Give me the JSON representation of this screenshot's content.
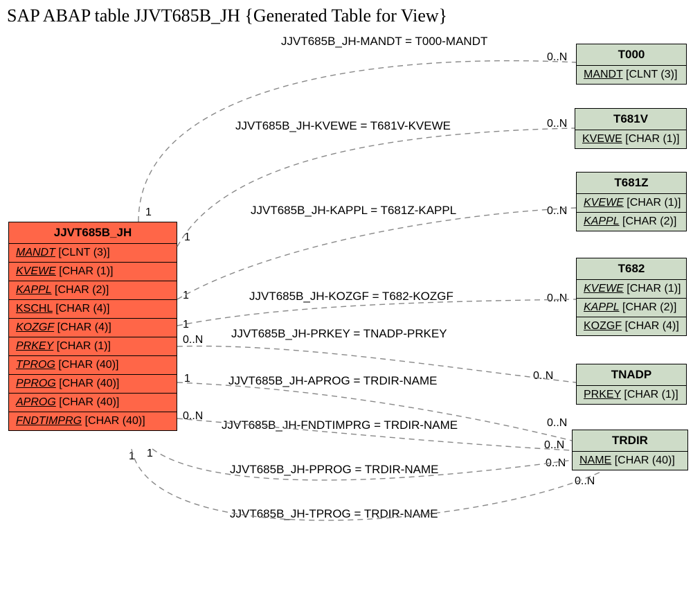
{
  "title": "SAP ABAP table JJVT685B_JH {Generated Table for View}",
  "main": {
    "name": "JJVT685B_JH",
    "fields": [
      {
        "name": "MANDT",
        "type": "[CLNT (3)]",
        "style": "fk"
      },
      {
        "name": "KVEWE",
        "type": "[CHAR (1)]",
        "style": "fk"
      },
      {
        "name": "KAPPL",
        "type": "[CHAR (2)]",
        "style": "fk"
      },
      {
        "name": "KSCHL",
        "type": "[CHAR (4)]",
        "style": "k"
      },
      {
        "name": "KOZGF",
        "type": "[CHAR (4)]",
        "style": "fk"
      },
      {
        "name": "PRKEY",
        "type": "[CHAR (1)]",
        "style": "fk"
      },
      {
        "name": "TPROG",
        "type": "[CHAR (40)]",
        "style": "fk"
      },
      {
        "name": "PPROG",
        "type": "[CHAR (40)]",
        "style": "fk"
      },
      {
        "name": "APROG",
        "type": "[CHAR (40)]",
        "style": "fk"
      },
      {
        "name": "FNDTIMPRG",
        "type": "[CHAR (40)]",
        "style": "fk"
      }
    ]
  },
  "targets": [
    {
      "name": "T000",
      "fields": [
        {
          "name": "MANDT",
          "type": "[CLNT (3)]",
          "style": "k"
        }
      ]
    },
    {
      "name": "T681V",
      "fields": [
        {
          "name": "KVEWE",
          "type": "[CHAR (1)]",
          "style": "k"
        }
      ]
    },
    {
      "name": "T681Z",
      "fields": [
        {
          "name": "KVEWE",
          "type": "[CHAR (1)]",
          "style": "fk"
        },
        {
          "name": "KAPPL",
          "type": "[CHAR (2)]",
          "style": "fk"
        }
      ]
    },
    {
      "name": "T682",
      "fields": [
        {
          "name": "KVEWE",
          "type": "[CHAR (1)]",
          "style": "fk"
        },
        {
          "name": "KAPPL",
          "type": "[CHAR (2)]",
          "style": "fk"
        },
        {
          "name": "KOZGF",
          "type": "[CHAR (4)]",
          "style": "k"
        }
      ]
    },
    {
      "name": "TNADP",
      "fields": [
        {
          "name": "PRKEY",
          "type": "[CHAR (1)]",
          "style": "k"
        }
      ]
    },
    {
      "name": "TRDIR",
      "fields": [
        {
          "name": "NAME",
          "type": "[CHAR (40)]",
          "style": "k"
        }
      ]
    }
  ],
  "edges": [
    {
      "label": "JJVT685B_JH-MANDT = T000-MANDT",
      "lc": "1",
      "rc": "0..N"
    },
    {
      "label": "JJVT685B_JH-KVEWE = T681V-KVEWE",
      "lc": "1",
      "rc": "0..N"
    },
    {
      "label": "JJVT685B_JH-KAPPL = T681Z-KAPPL",
      "lc": "1",
      "rc": "0..N"
    },
    {
      "label": "JJVT685B_JH-KOZGF = T682-KOZGF",
      "lc": "1",
      "rc": "0..N"
    },
    {
      "label": "JJVT685B_JH-PRKEY = TNADP-PRKEY",
      "lc": "0..N",
      "rc": "0..N"
    },
    {
      "label": "JJVT685B_JH-APROG = TRDIR-NAME",
      "lc": "1",
      "rc": "0..N"
    },
    {
      "label": "JJVT685B_JH-FNDTIMPRG = TRDIR-NAME",
      "lc": "0..N",
      "rc": "0..N"
    },
    {
      "label": "JJVT685B_JH-PPROG = TRDIR-NAME",
      "lc": "1",
      "rc": "0..N"
    },
    {
      "label": "JJVT685B_JH-TPROG = TRDIR-NAME",
      "lc": "1",
      "rc": "0..N"
    }
  ]
}
